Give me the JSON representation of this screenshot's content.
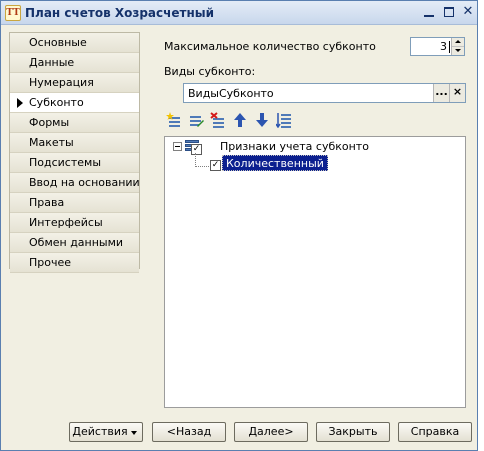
{
  "window": {
    "title": "План счетов Хозрасчетный",
    "icon": "1c-app-icon",
    "icon_text": "ТТ"
  },
  "tabs": {
    "items": [
      {
        "label": "Основные"
      },
      {
        "label": "Данные"
      },
      {
        "label": "Нумерация"
      },
      {
        "label": "Субконто",
        "active": true
      },
      {
        "label": "Формы"
      },
      {
        "label": "Макеты"
      },
      {
        "label": "Подсистемы"
      },
      {
        "label": "Ввод на основании"
      },
      {
        "label": "Права"
      },
      {
        "label": "Интерфейсы"
      },
      {
        "label": "Обмен данными"
      },
      {
        "label": "Прочее"
      }
    ]
  },
  "subconto": {
    "max_label": "Максимальное количество субконто",
    "max_value": "3",
    "types_label": "Виды субконто:",
    "types_value": "ВидыСубконто",
    "browse_button": "...",
    "clear_button": "×"
  },
  "toolbar": {
    "icons": [
      "add-icon",
      "edit-icon",
      "delete-icon",
      "move-up-icon",
      "move-down-icon",
      "sort-icon"
    ]
  },
  "tree": {
    "root_label": "Признаки учета субконто",
    "root_checked": true,
    "child_label": "Количественный",
    "child_checked": true
  },
  "buttons": {
    "actions": "Действия",
    "back": "<Назад",
    "next": "Далее>",
    "close": "Закрыть",
    "help": "Справка"
  }
}
